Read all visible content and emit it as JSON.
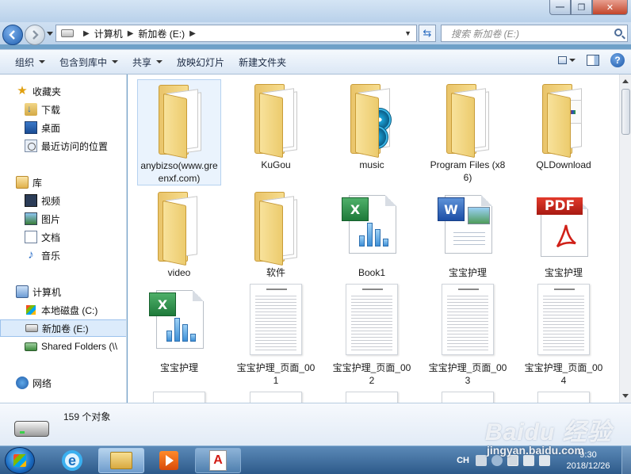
{
  "window": {
    "min_glyph": "—",
    "max_glyph": "❐",
    "close_glyph": "✕"
  },
  "address": {
    "crumbs": [
      "计算机",
      "新加卷 (E:)"
    ],
    "search_placeholder": "搜索 新加卷 (E:)"
  },
  "toolbar": {
    "organize": "组织",
    "include_library": "包含到库中",
    "share": "共享",
    "slideshow": "放映幻灯片",
    "new_folder": "新建文件夹",
    "help": "?"
  },
  "nav": {
    "favorites": "收藏夹",
    "downloads": "下载",
    "desktop": "桌面",
    "recent": "最近访问的位置",
    "libraries": "库",
    "videos": "视频",
    "pictures": "图片",
    "documents": "文档",
    "music": "音乐",
    "computer": "计算机",
    "local_disk": "本地磁盘 (C:)",
    "new_volume": "新加卷 (E:)",
    "shared_folders": "Shared Folders (\\\\",
    "network": "网络"
  },
  "files": [
    {
      "name": "anybizso(www.greenxf.com)",
      "type": "folder"
    },
    {
      "name": "KuGou",
      "type": "folder"
    },
    {
      "name": "music",
      "type": "folder-media"
    },
    {
      "name": "Program Files (x86)",
      "type": "folder"
    },
    {
      "name": "QLDownload",
      "type": "folder-thumb"
    },
    {
      "name": "video",
      "type": "folder-empty"
    },
    {
      "name": "软件",
      "type": "folder"
    },
    {
      "name": "Book1",
      "type": "excel"
    },
    {
      "name": "宝宝护理",
      "type": "word"
    },
    {
      "name": "宝宝护理",
      "type": "pdf"
    },
    {
      "name": "宝宝护理",
      "type": "excel"
    },
    {
      "name": "宝宝护理_页面_001",
      "type": "page"
    },
    {
      "name": "宝宝护理_页面_002",
      "type": "page"
    },
    {
      "name": "宝宝护理_页面_003",
      "type": "page"
    },
    {
      "name": "宝宝护理_页面_004",
      "type": "page"
    }
  ],
  "icon_glyphs": {
    "excel": "X",
    "word": "W",
    "pdf": "PDF",
    "ie": "e",
    "acrobat": "A"
  },
  "details": {
    "count": "159 个对象"
  },
  "taskbar": {
    "lang": "CH",
    "time": "9:30",
    "date": "2018/12/26"
  },
  "watermark": {
    "brand": "Baidu 经验",
    "url": "jingyan.baidu.com"
  }
}
